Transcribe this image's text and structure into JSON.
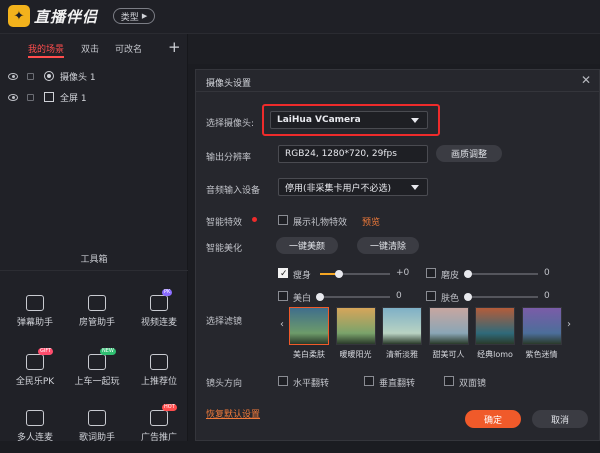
{
  "app": {
    "title": "直播伴侣",
    "type_button": "类型"
  },
  "scene_tabs": [
    "我的场景",
    "双击",
    "可改名"
  ],
  "scenes": [
    {
      "label": "摄像头 1",
      "icon": "camera-source-icon"
    },
    {
      "label": "全屏 1",
      "icon": "fullscreen-source-icon"
    }
  ],
  "toolbox": {
    "title": "工具箱",
    "tools": [
      {
        "label": "弹幕助手",
        "icon": "danmaku-icon",
        "badge": ""
      },
      {
        "label": "房管助手",
        "icon": "room-manager-icon",
        "badge": ""
      },
      {
        "label": "视频连麦",
        "icon": "video-mic-icon",
        "badge": "PK"
      },
      {
        "label": "全民乐PK",
        "icon": "pk-icon",
        "badge": "GIFT"
      },
      {
        "label": "上车一起玩",
        "icon": "car-icon",
        "badge": "NEW"
      },
      {
        "label": "上推荐位",
        "icon": "buff-icon",
        "badge": ""
      },
      {
        "label": "多人连麦",
        "icon": "multi-mic-icon",
        "badge": ""
      },
      {
        "label": "歌词助手",
        "icon": "lyrics-icon",
        "badge": ""
      },
      {
        "label": "广告推广",
        "icon": "ad-icon",
        "badge": "HOT"
      }
    ]
  },
  "dialog": {
    "title": "摄像头设置",
    "camera_label": "选择摄像头:",
    "camera_value": "LaiHua VCamera",
    "resolution_label": "输出分辨率",
    "resolution_value": "RGB24, 1280*720, 29fps",
    "quality_button": "画质调整",
    "audio_label": "音频输入设备",
    "audio_value": "停用(非采集卡用户不必选)",
    "effects_label": "智能特效",
    "show_gift_label": "展示礼物特效",
    "preview_link": "预览",
    "beauty_label": "智能美化",
    "one_key_beauty": "一键美颜",
    "one_key_clear": "一键清除",
    "sliders": [
      {
        "label": "瘦身",
        "value": "+0",
        "checked": true,
        "level": 0.45
      },
      {
        "label": "磨皮",
        "value": "0",
        "checked": false,
        "level": 0
      },
      {
        "label": "美白",
        "value": "0",
        "checked": false,
        "level": 0
      },
      {
        "label": "肤色",
        "value": "0",
        "checked": false,
        "level": 0
      }
    ],
    "filter_label": "选择滤镜",
    "filters": [
      "美白柔肤",
      "暖暖阳光",
      "清新淡雅",
      "甜美可人",
      "经典lomo",
      "紫色迷情"
    ],
    "mirror_label": "镜头方向",
    "mirror_options": [
      "水平翻转",
      "垂直翻转",
      "双面镜"
    ],
    "reset_link": "恢复默认设置",
    "ok_button": "确定",
    "cancel_button": "取消"
  },
  "colors": {
    "accent": "#ff4d4d",
    "orange": "#f05a2a",
    "highlight": "#ee2b2b"
  }
}
